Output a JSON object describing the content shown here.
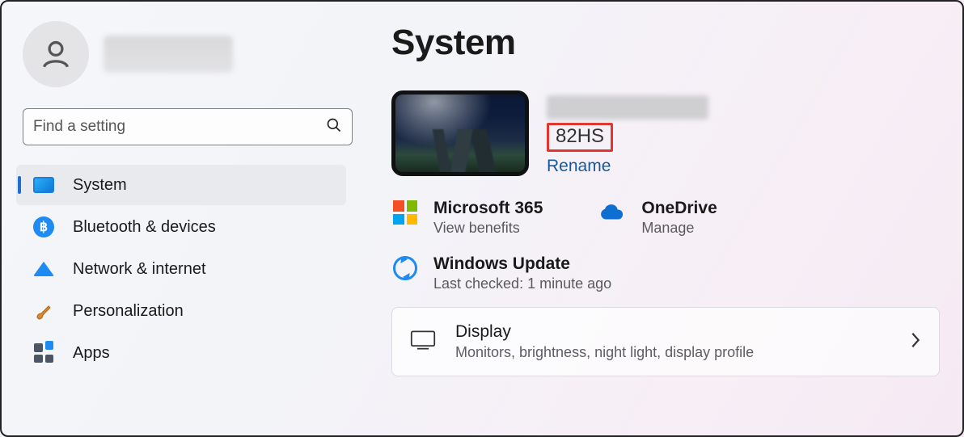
{
  "sidebar": {
    "search_placeholder": "Find a setting",
    "items": [
      {
        "label": "System"
      },
      {
        "label": "Bluetooth & devices"
      },
      {
        "label": "Network & internet"
      },
      {
        "label": "Personalization"
      },
      {
        "label": "Apps"
      }
    ]
  },
  "page": {
    "title": "System",
    "device": {
      "model": "82HS",
      "rename_label": "Rename"
    },
    "services": {
      "m365": {
        "title": "Microsoft 365",
        "sub": "View benefits"
      },
      "onedrive": {
        "title": "OneDrive",
        "sub": "Manage"
      },
      "update": {
        "title": "Windows Update",
        "sub": "Last checked: 1 minute ago"
      }
    },
    "cards": {
      "display": {
        "title": "Display",
        "sub": "Monitors, brightness, night light, display profile"
      }
    }
  }
}
